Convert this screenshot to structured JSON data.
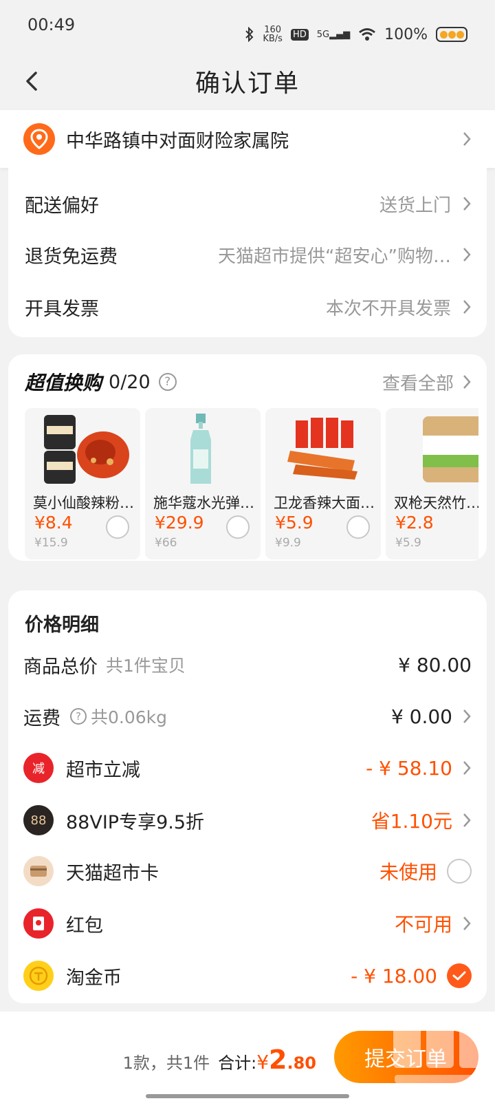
{
  "status_bar": {
    "time": "00:49",
    "net_speed_top": "160",
    "net_speed_unit": "KB/s",
    "hd": "HD",
    "signal": "5G",
    "battery": "100%"
  },
  "header": {
    "title": "确认订单"
  },
  "address": {
    "text": "中华路镇中对面财险家属院"
  },
  "delivery": {
    "rows": [
      {
        "label": "配送偏好",
        "value": "送货上门"
      },
      {
        "label": "退货免运费",
        "value": "天猫超市提供“超安心”购物…"
      },
      {
        "label": "开具发票",
        "value": "本次不开具发票"
      }
    ]
  },
  "swap": {
    "title": "超值换购",
    "count": "0/20",
    "help": "?",
    "view_all": "查看全部",
    "products": [
      {
        "name": "莫小仙酸辣粉…",
        "price": "¥8.4",
        "orig": "¥15.9"
      },
      {
        "name": "施华蔻水光弹…",
        "price": "¥29.9",
        "orig": "¥66"
      },
      {
        "name": "卫龙香辣大面…",
        "price": "¥5.9",
        "orig": "¥9.9"
      },
      {
        "name": "双枪天然竹…",
        "price": "¥2.8",
        "orig": "¥5.9"
      }
    ]
  },
  "price_detail": {
    "title": "价格明细",
    "items_total": {
      "label": "商品总价",
      "sub": "共1件宝贝",
      "value": "¥ 80.00"
    },
    "shipping": {
      "label": "运费",
      "sub": "共0.06kg",
      "value": "¥ 0.00"
    },
    "supermarket_discount": {
      "label": "超市立减",
      "icon": "减",
      "value": "- ¥ 58.10"
    },
    "vip": {
      "label": "88VIP专享9.5折",
      "icon": "88",
      "value": "省1.10元"
    },
    "card": {
      "label": "天猫超市卡",
      "value": "未使用"
    },
    "redpacket": {
      "label": "红包",
      "value": "不可用"
    },
    "coins": {
      "label": "淘金币",
      "value": "- ¥ 18.00"
    }
  },
  "footer": {
    "count": "1款，共1件",
    "total_label": "合计:",
    "currency": "¥",
    "total_int": "2",
    "total_dec": ".80",
    "submit": "提交订单"
  },
  "colors": {
    "accent": "#ff5000",
    "button_start": "#ff9a00",
    "background": "#f2f2f2"
  }
}
